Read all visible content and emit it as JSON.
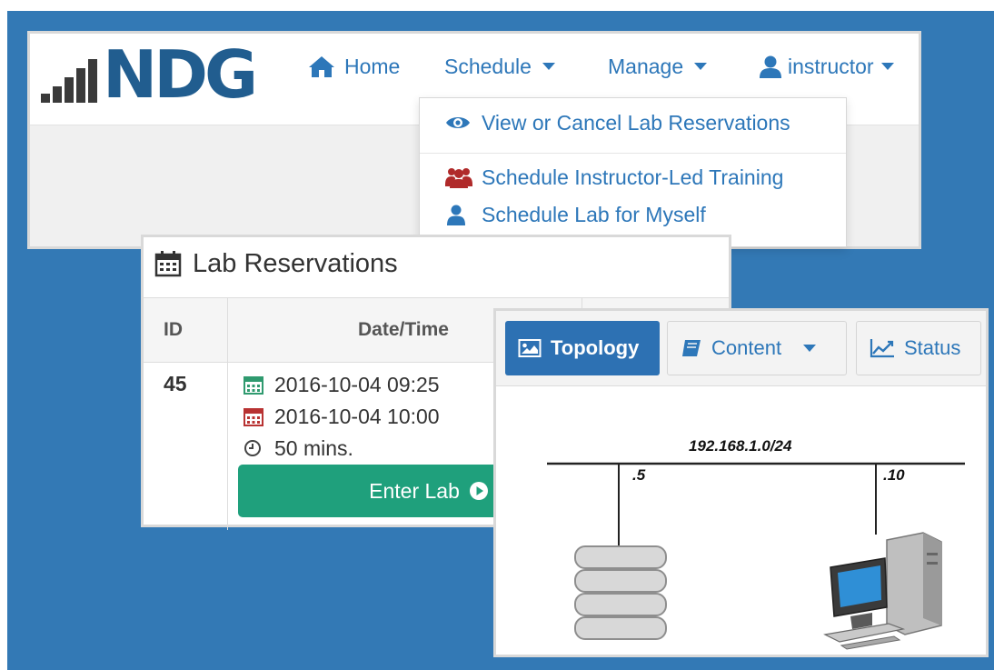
{
  "brand": {
    "logo_text": "NDG"
  },
  "navbar": {
    "home": "Home",
    "schedule": "Schedule",
    "manage": "Manage",
    "user": "instructor"
  },
  "schedule_menu": {
    "items": [
      {
        "label": "View or Cancel Lab Reservations",
        "icon": "eye-icon"
      },
      {
        "label": "Schedule Instructor-Led Training",
        "icon": "users-icon"
      },
      {
        "label": "Schedule Lab for Myself",
        "icon": "user-icon"
      }
    ]
  },
  "reservations": {
    "title": "Lab Reservations",
    "columns": [
      "ID",
      "Date/Time"
    ],
    "row": {
      "id": "45",
      "start": "2016-10-04 09:25",
      "end": "2016-10-04 10:00",
      "duration": "50 mins.",
      "enter_label": "Enter Lab"
    }
  },
  "lab_tabs": {
    "topology": "Topology",
    "content": "Content",
    "status": "Status"
  },
  "topology": {
    "network": "192.168.1.0/24",
    "host_left": ".5",
    "host_right": ".10"
  },
  "colors": {
    "background": "#3379b5",
    "link": "#2d77b9",
    "primary": "#2d71b3",
    "success": "#1fa07c",
    "logo": "#215d8f"
  }
}
